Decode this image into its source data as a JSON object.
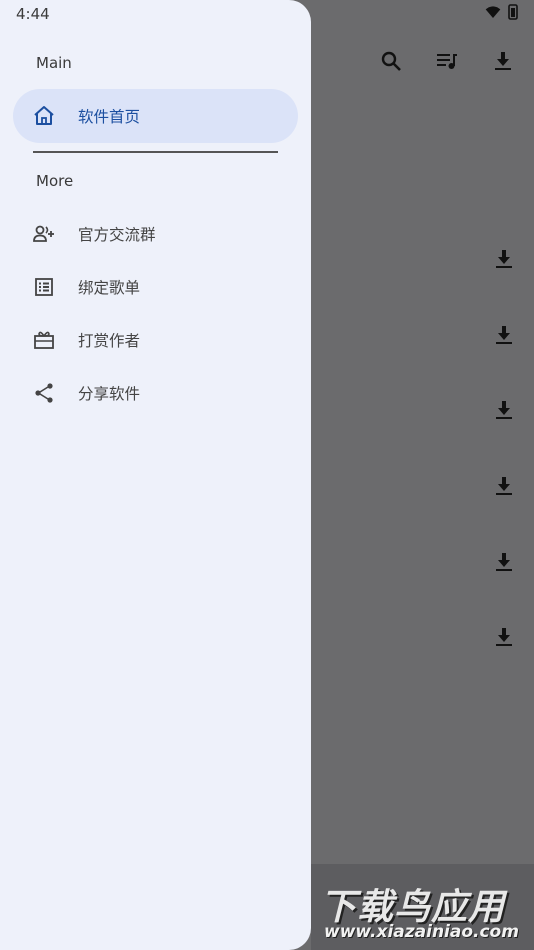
{
  "status_bar": {
    "time": "4:44"
  },
  "drawer": {
    "main_section": "Main",
    "more_section": "More",
    "items": [
      {
        "label": "软件首页",
        "icon": "home-icon",
        "active": true
      },
      {
        "label": "官方交流群",
        "icon": "group-add-icon",
        "active": false
      },
      {
        "label": "绑定歌单",
        "icon": "list-alt-icon",
        "active": false
      },
      {
        "label": "打赏作者",
        "icon": "gift-icon",
        "active": false
      },
      {
        "label": "分享软件",
        "icon": "share-icon",
        "active": false
      }
    ]
  },
  "toolbar": {
    "icons": [
      "search-icon",
      "queue-music-icon",
      "download-icon"
    ]
  },
  "download_buttons": 6,
  "watermark": {
    "title": "下载鸟应用",
    "url": "www.xiazainiao.com"
  },
  "colors": {
    "drawer_bg": "#eef1fa",
    "active_bg": "#dbe3f8",
    "active_text": "#1c4fa0",
    "scrim": "#6b6b6d"
  }
}
